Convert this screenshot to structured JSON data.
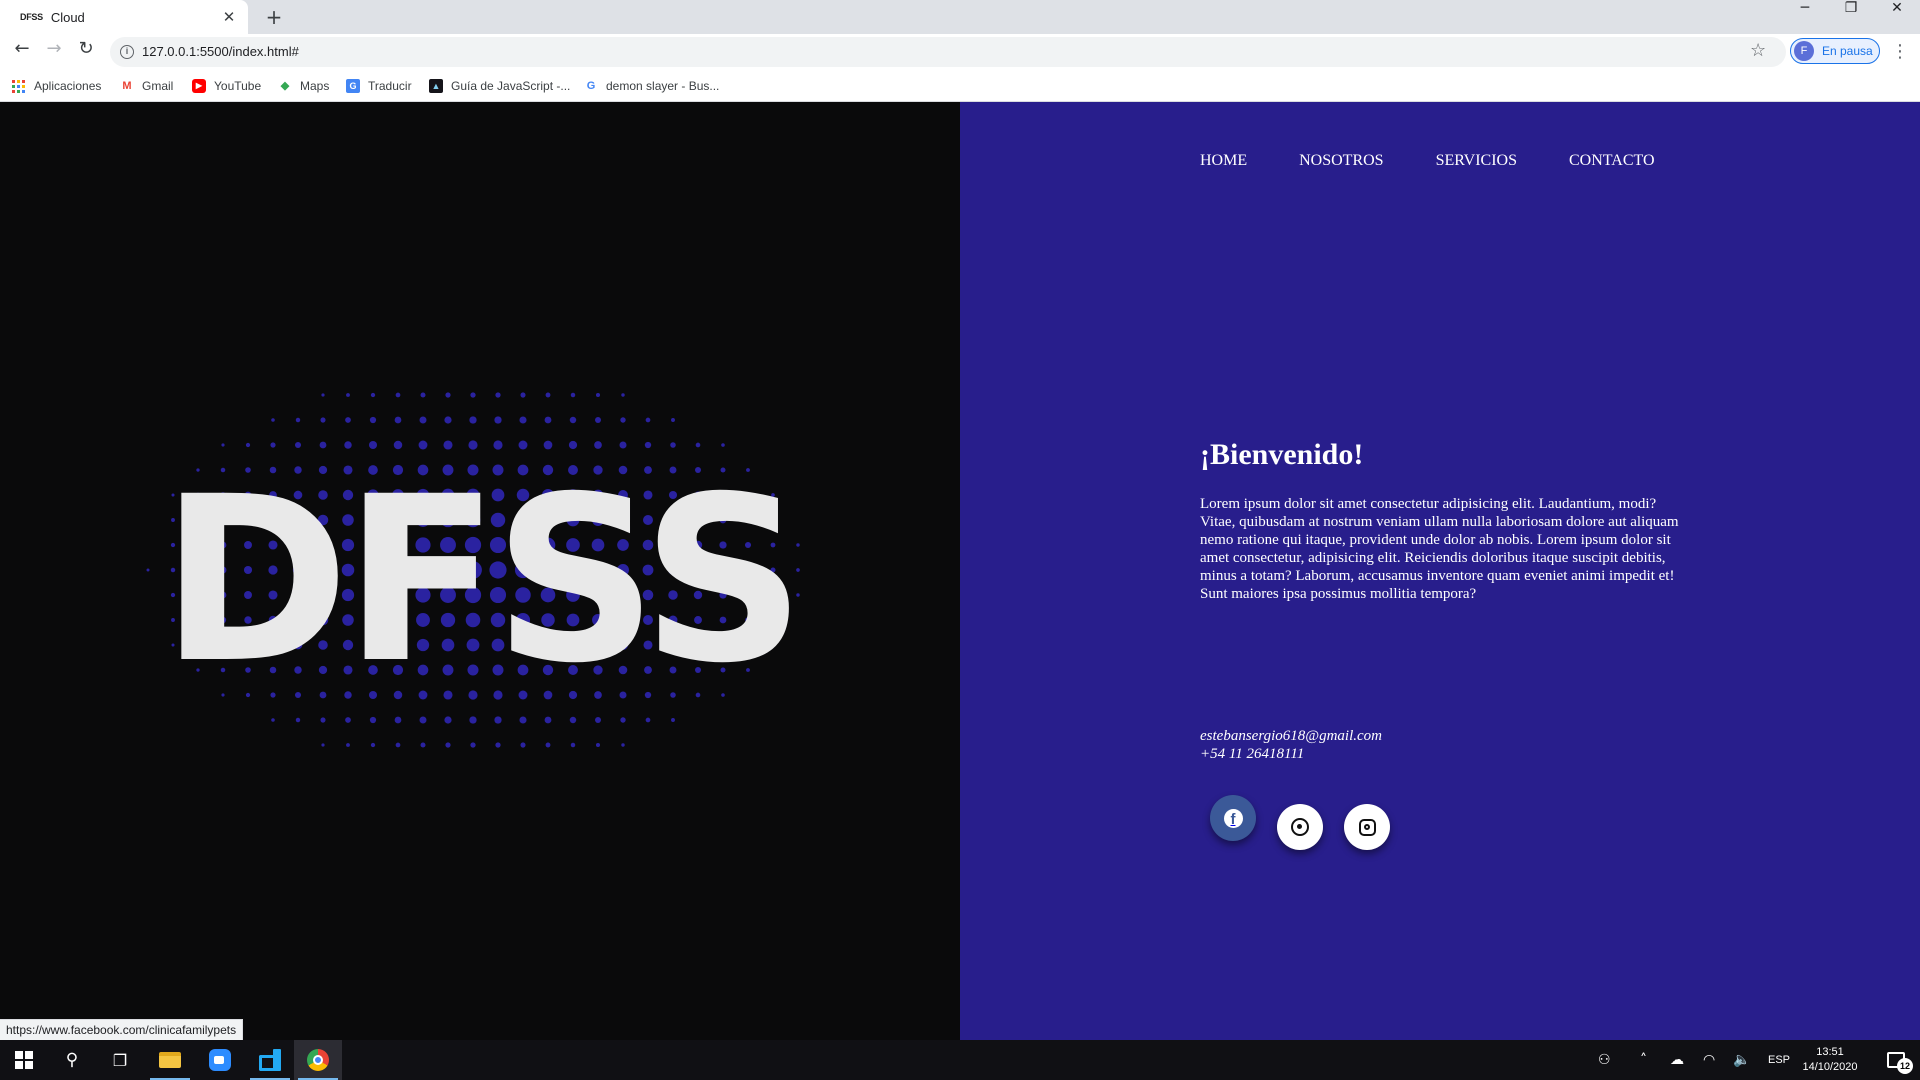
{
  "browser": {
    "tab": {
      "favicon_text": "DFSS",
      "title": "Cloud"
    },
    "url": "127.0.0.1:5500/index.html#",
    "profile": {
      "initial": "F",
      "label": "En pausa"
    },
    "bookmarks": [
      {
        "label": "Aplicaciones",
        "icon": "apps-grid-icon"
      },
      {
        "label": "Gmail",
        "icon": "gmail-icon"
      },
      {
        "label": "YouTube",
        "icon": "youtube-icon"
      },
      {
        "label": "Maps",
        "icon": "maps-icon"
      },
      {
        "label": "Traducir",
        "icon": "translate-icon"
      },
      {
        "label": "Guía de JavaScript -...",
        "icon": "mdn-icon"
      },
      {
        "label": "demon slayer - Bus...",
        "icon": "google-icon"
      }
    ],
    "status_url": "https://www.facebook.com/clinicafamilypets"
  },
  "page": {
    "logo_text": "DFSS",
    "nav": [
      "HOME",
      "NOSOTROS",
      "SERVICIOS",
      "CONTACTO"
    ],
    "welcome_title": "¡Bienvenido!",
    "welcome_text": "Lorem ipsum dolor sit amet consectetur adipisicing elit. Laudantium, modi? Vitae, quibusdam at nostrum veniam ullam nulla laboriosam dolore aut aliquam nemo ratione qui itaque, provident unde dolor ab nobis. Lorem ipsum dolor sit amet consectetur, adipisicing elit. Reiciendis doloribus itaque suscipit debitis, minus a totam? Laborum, accusamus inventore quam eveniet animi impedit et! Sunt maiores ipsa possimus mollitia tempora?",
    "email": "estebansergio618@gmail.com",
    "phone": "+54 11 26418111",
    "social": [
      "facebook-icon",
      "whatsapp-icon",
      "instagram-icon"
    ]
  },
  "taskbar": {
    "language": "ESP",
    "time": "13:51",
    "date": "14/10/2020",
    "notifications_count": "12"
  },
  "colors": {
    "left_bg": "#0a0a0b",
    "right_bg": "#281e8c",
    "logo_text": "#e9e9e9",
    "logo_dots": "#2a22a0",
    "facebook": "#3b5998"
  }
}
